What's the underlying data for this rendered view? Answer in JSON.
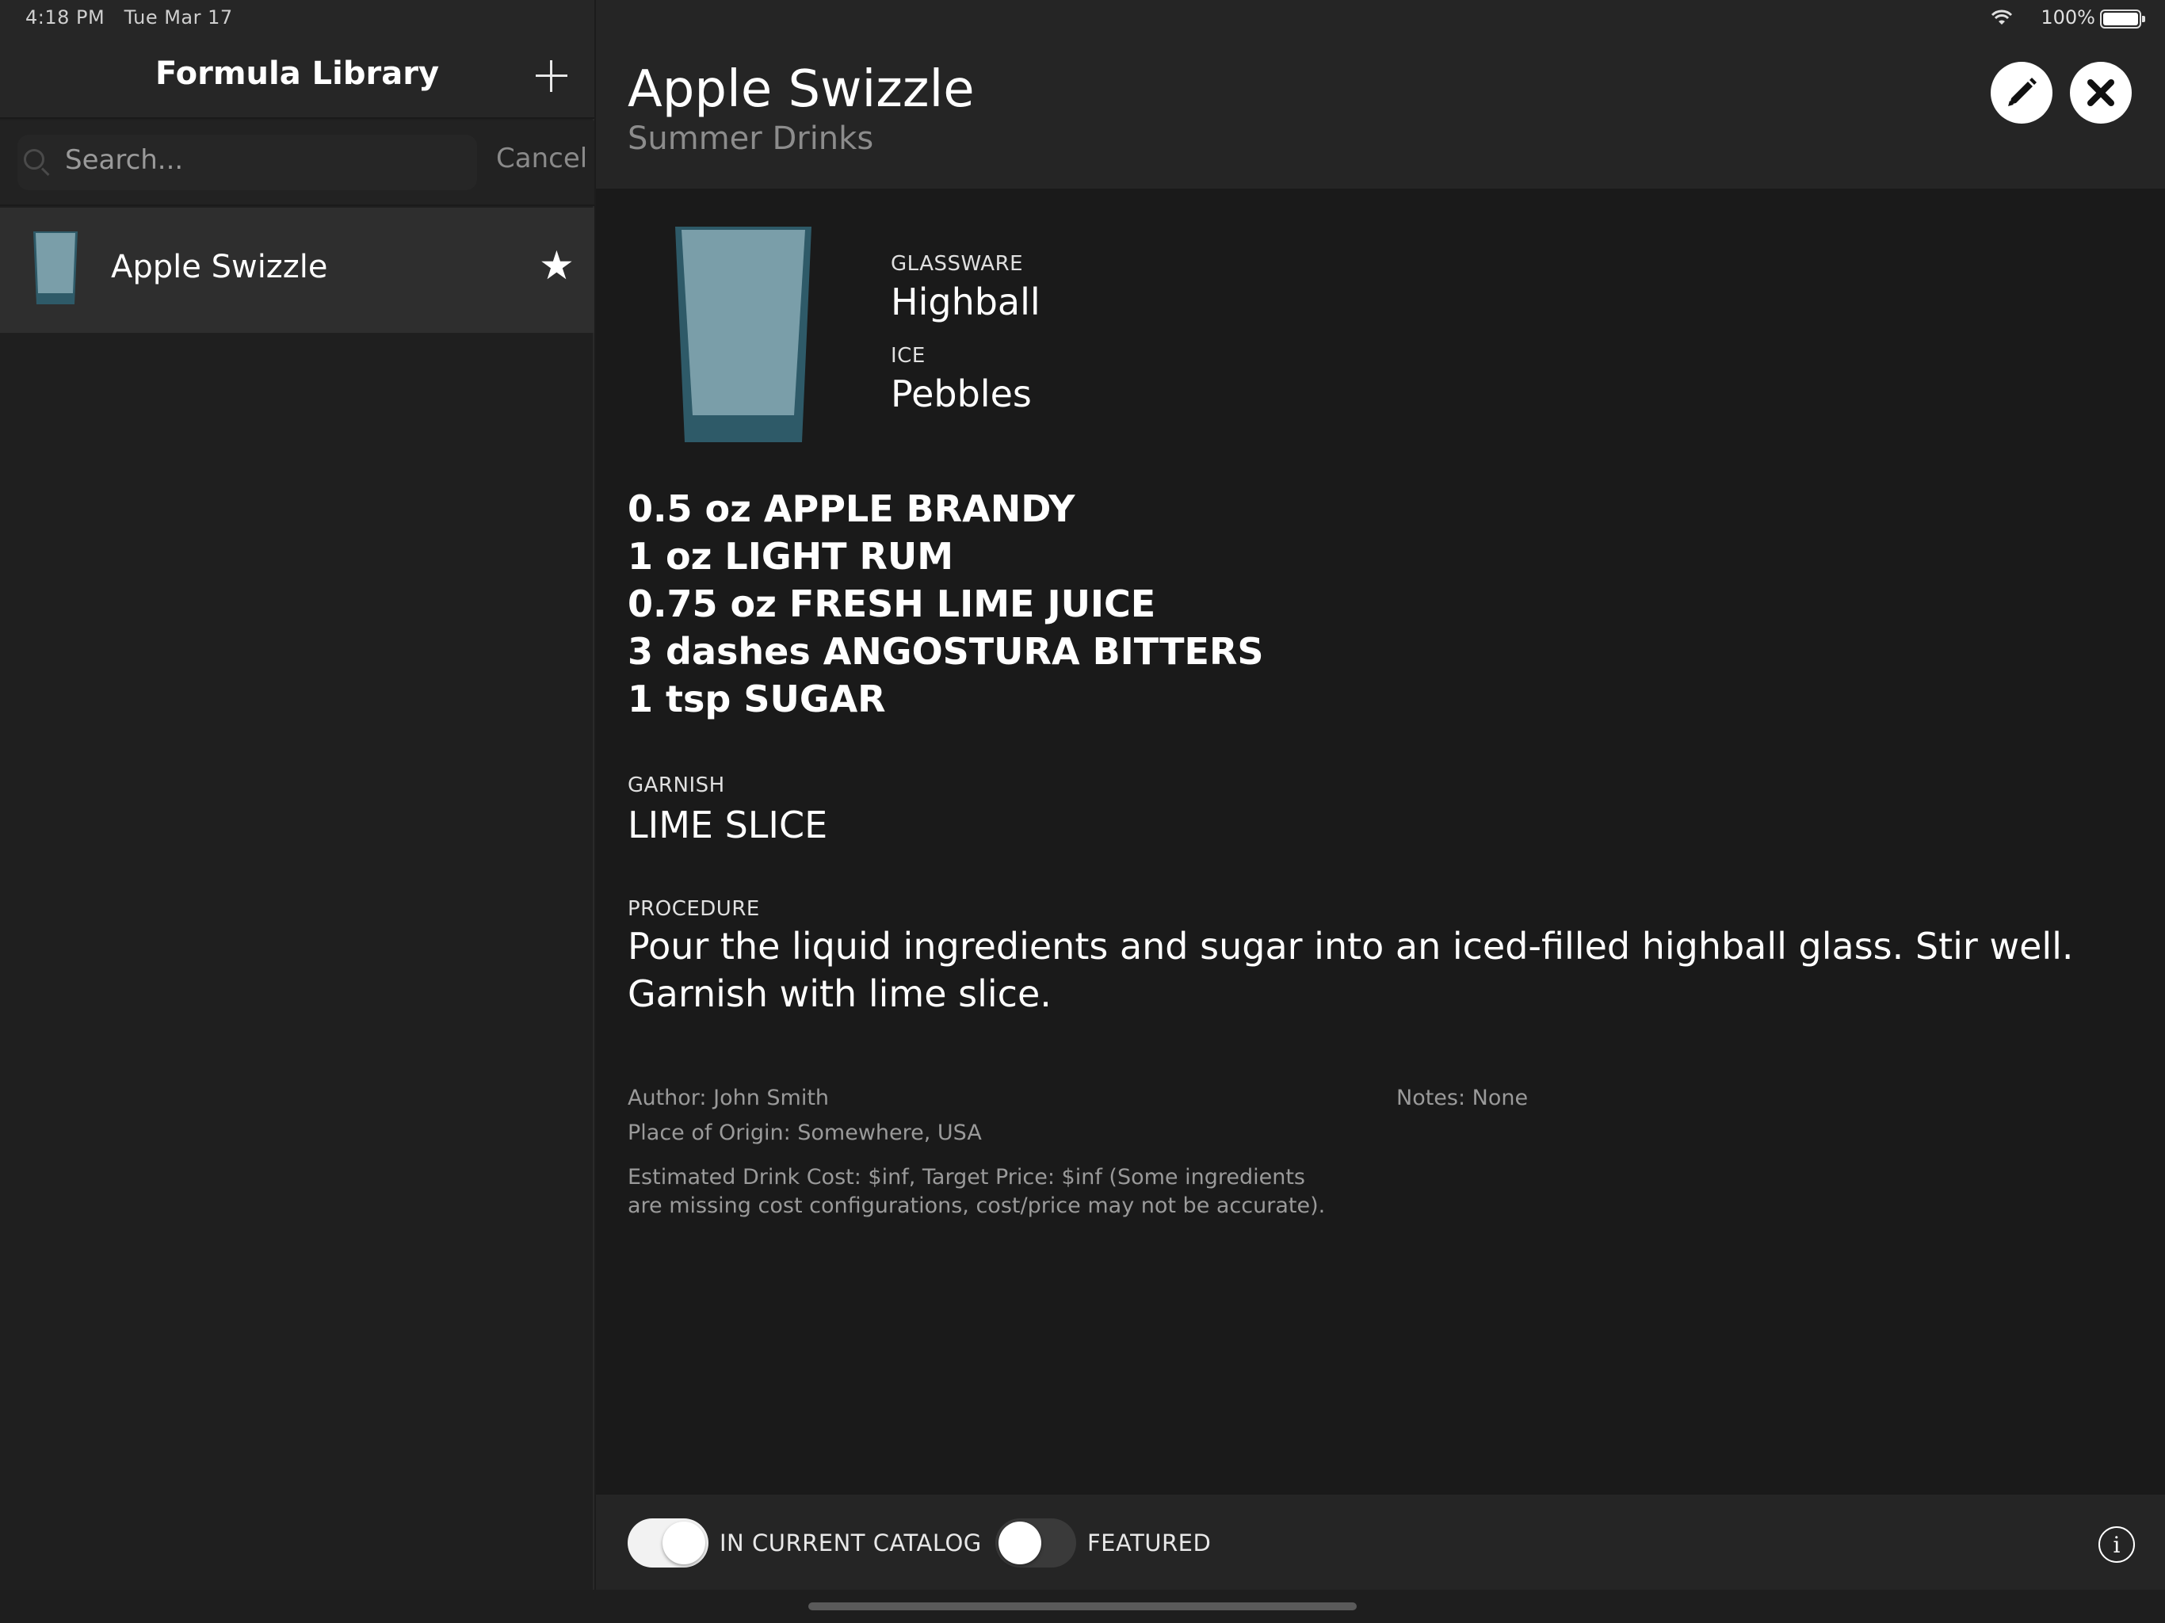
{
  "status_bar": {
    "time": "4:18 PM",
    "date": "Tue Mar 17",
    "battery_percent": "100%",
    "battery_level": 1.0
  },
  "sidebar": {
    "title": "Formula Library",
    "add_icon": "plus-icon",
    "search": {
      "placeholder": "Search...",
      "value": "",
      "cancel_label": "Cancel"
    },
    "items": [
      {
        "label": "Apple Swizzle",
        "favorite": true,
        "selected": true
      }
    ]
  },
  "detail": {
    "title": "Apple Swizzle",
    "category": "Summer Drinks",
    "edit_icon": "pencil-icon",
    "close_icon": "close-icon",
    "glassware_label": "GLASSWARE",
    "glassware_value": "Highball",
    "ice_label": "ICE",
    "ice_value": "Pebbles",
    "ingredients": [
      "0.5 oz APPLE BRANDY",
      "1 oz LIGHT RUM",
      "0.75 oz FRESH LIME JUICE",
      "3 dashes ANGOSTURA BITTERS",
      "1 tsp SUGAR"
    ],
    "garnish_label": "GARNISH",
    "garnish_value": "LIME SLICE",
    "procedure_label": "PROCEDURE",
    "procedure_text": "Pour the liquid ingredients and sugar into an iced-filled highball glass. Stir well. Garnish with lime slice.",
    "author": "Author: John Smith",
    "origin": "Place of Origin: Somewhere, USA",
    "cost_note": "Estimated Drink Cost: $inf, Target Price: $inf (Some ingredients are missing cost configurations, cost/price may not be accurate).",
    "notes": "Notes: None"
  },
  "bottom_bar": {
    "catalog_label": "IN CURRENT CATALOG",
    "catalog_on": true,
    "featured_label": "FEATURED",
    "featured_on": false,
    "info_icon": "info-icon"
  },
  "colors": {
    "glass_light": "#7a9ea9",
    "glass_dark": "#2e5a68",
    "toggle_on": "#f2f2f2",
    "toggle_off": "#3a3a3a"
  }
}
